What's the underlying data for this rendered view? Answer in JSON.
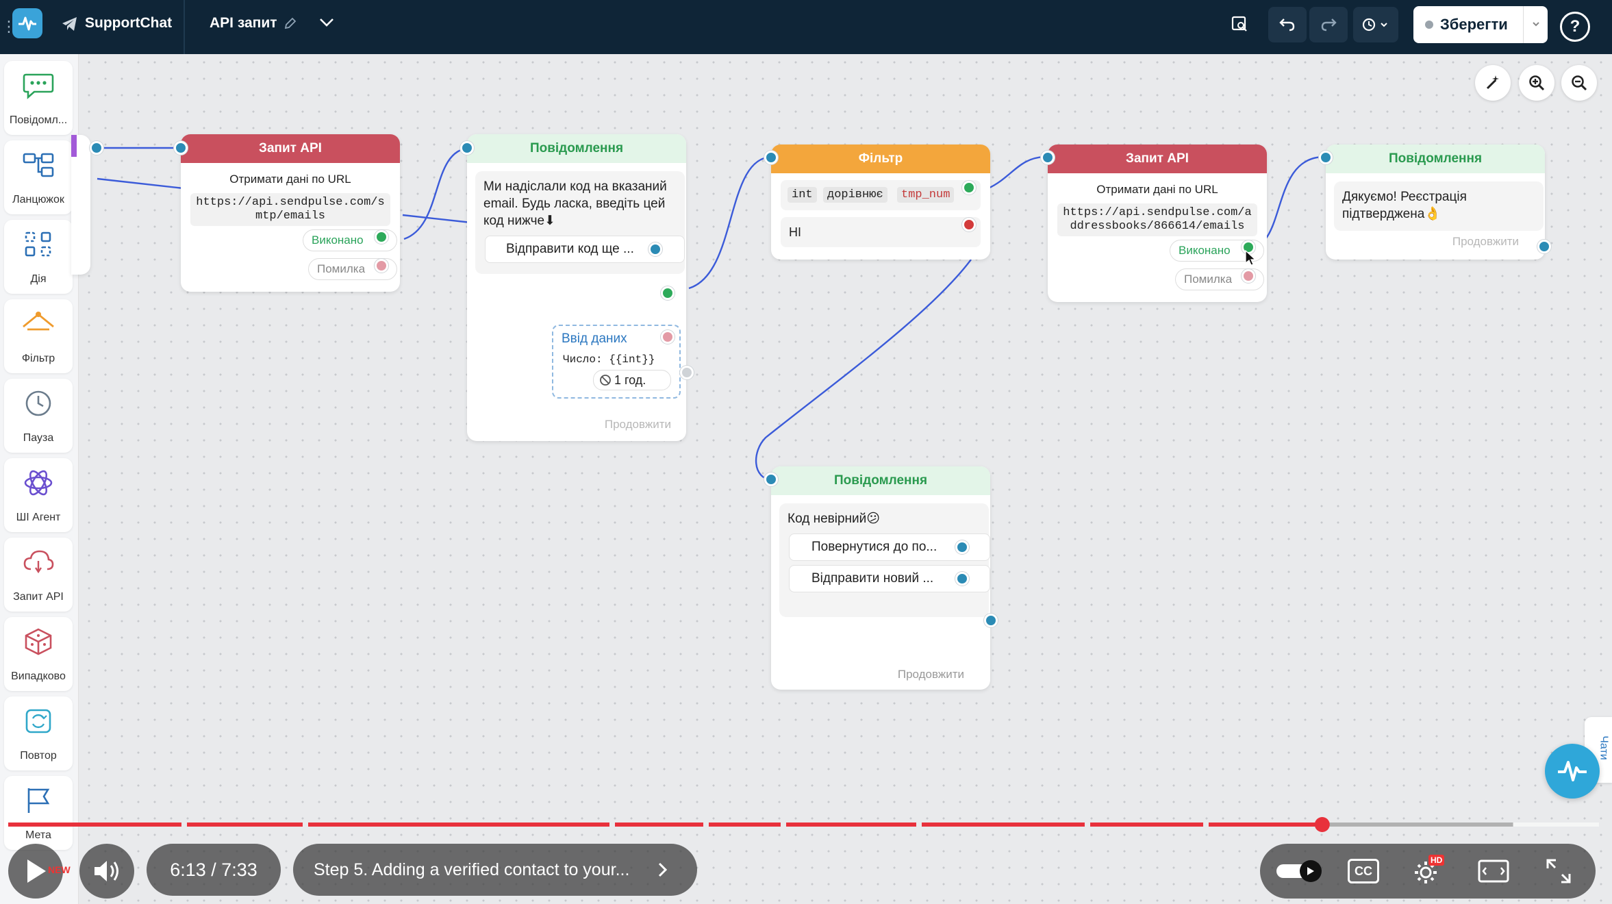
{
  "topbar": {
    "bot_name": "SupportChat",
    "flow_name": "API запит",
    "save_label": "Зберегти"
  },
  "sidebar": {
    "items": [
      {
        "label": "Повідомл...",
        "icon": "chat-bubble-icon"
      },
      {
        "label": "Ланцюжок",
        "icon": "chain-icon"
      },
      {
        "label": "Дія",
        "icon": "action-grid-icon"
      },
      {
        "label": "Фільтр",
        "icon": "filter-icon"
      },
      {
        "label": "Пауза",
        "icon": "clock-icon"
      },
      {
        "label": "ШІ Агент",
        "icon": "ai-agent-icon"
      },
      {
        "label": "Запит API",
        "icon": "cloud-api-icon"
      },
      {
        "label": "Випадково",
        "icon": "dice-icon"
      },
      {
        "label": "Повтор",
        "icon": "repeat-icon"
      },
      {
        "label": "Мета",
        "icon": "flag-icon"
      }
    ]
  },
  "nodes": {
    "api1": {
      "title": "Запит API",
      "desc": "Отримати дані по URL",
      "url": "https://api.sendpulse.com/smtp/emails",
      "ok": "Виконано",
      "err": "Помилка"
    },
    "msg1": {
      "title": "Повідомлення",
      "text": "Ми надіслали код на вказаний email. Будь ласка, введіть цей код нижче⬇",
      "button": "Відправити код ще ...",
      "input_title": "Ввід даних",
      "input_type": "Число: {{int}}",
      "timeout": "1 год.",
      "continue": "Продовжити"
    },
    "filter": {
      "title": "Фільтр",
      "token1": "int",
      "token2": "дорівнює",
      "token3": "tmp_num",
      "else": "НІ"
    },
    "api2": {
      "title": "Запит API",
      "desc": "Отримати дані по URL",
      "url": "https://api.sendpulse.com/addressbooks/866614/emails",
      "ok": "Виконано",
      "err": "Помилка"
    },
    "msg2": {
      "title": "Повідомлення",
      "text": "Дякуємо! Реєстрація підтверджена👌",
      "continue": "Продовжити"
    },
    "msg3": {
      "title": "Повідомлення",
      "text": "Код невірний😕",
      "button1": "Повернутися до по...",
      "button2": "Відправити новий ...",
      "continue": "Продовжити"
    }
  },
  "side_tab": "Чати",
  "player": {
    "time": "6:13 / 7:33",
    "chapter": "Step 5. Adding a verified contact to your...",
    "progress": 0.826,
    "new_badge": "NEW",
    "hd_badge": "HD",
    "cc_label": "CC"
  }
}
